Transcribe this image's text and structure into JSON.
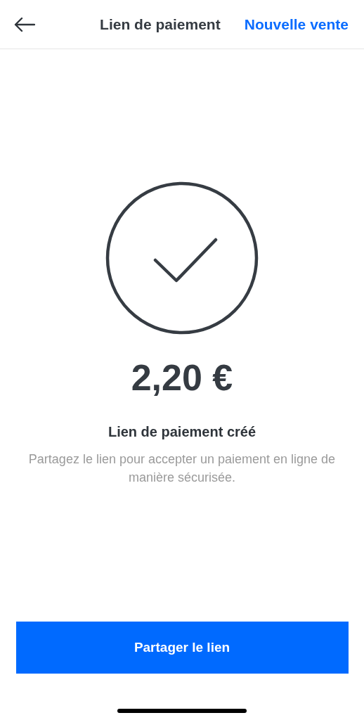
{
  "header": {
    "title": "Lien de paiement",
    "action": "Nouvelle vente"
  },
  "amount": "2,20 €",
  "status_title": "Lien de paiement créé",
  "description": "Partagez le lien pour accepter un paiement en ligne de manière sécurisée.",
  "primary_button": "Partager le lien"
}
